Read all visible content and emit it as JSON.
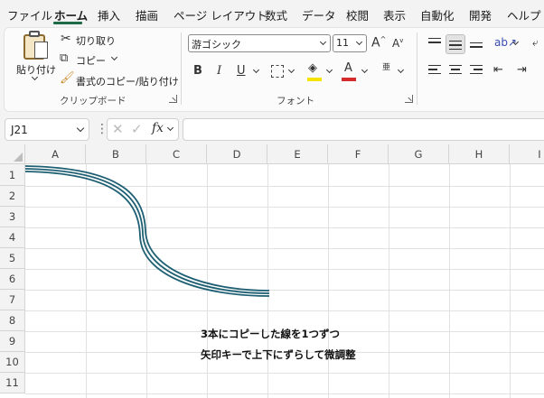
{
  "menu": {
    "tabs": [
      "ファイル",
      "ホーム",
      "挿入",
      "描画",
      "ページ レイアウト",
      "数式",
      "データ",
      "校閲",
      "表示",
      "自動化",
      "開発",
      "ヘルプ"
    ],
    "active": "ホーム"
  },
  "ribbon": {
    "clipboard": {
      "paste_label": "貼り付け",
      "cut_label": "切り取り",
      "copy_label": "コピー",
      "format_painter_label": "書式のコピー/貼り付け",
      "group_label": "クリップボード"
    },
    "font": {
      "font_name": "游ゴシック",
      "font_size": "11",
      "group_label": "フォント",
      "bold": "B",
      "italic": "I",
      "underline": "U",
      "grow": "A",
      "shrink": "A",
      "font_color_letter": "A",
      "phonetic_letter": "亜",
      "fill_color": "#f5e400",
      "font_color": "#d62b2b"
    }
  },
  "formula_bar": {
    "name_box": "J21",
    "fx": "fx",
    "formula": ""
  },
  "sheet": {
    "columns": [
      "A",
      "B",
      "C",
      "D",
      "E",
      "F",
      "G",
      "H",
      "I"
    ],
    "rows": [
      "1",
      "2",
      "3",
      "4",
      "5",
      "6",
      "7",
      "8",
      "9",
      "10",
      "11"
    ],
    "note_line1": "3本にコピーした線を1つずつ",
    "note_line2": "矢印キーで上下にずらして微調整",
    "curve_color": "#1e5f73"
  }
}
